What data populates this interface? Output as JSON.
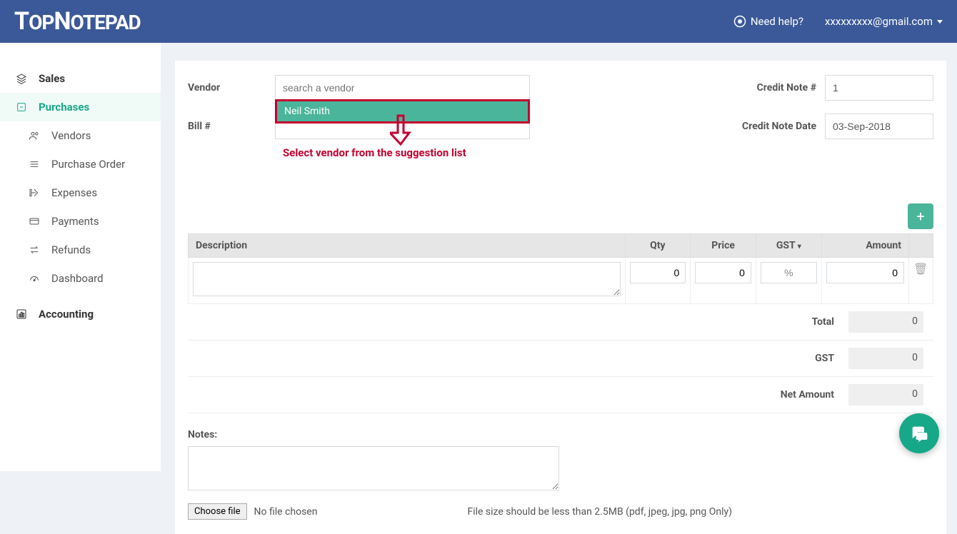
{
  "header": {
    "logo": "TOPNOTEPAD",
    "help": "Need help?",
    "user": "xxxxxxxxx@gmail.com"
  },
  "sidebar": {
    "sales": "Sales",
    "purchases": "Purchases",
    "vendors": "Vendors",
    "purchaseOrder": "Purchase Order",
    "expenses": "Expenses",
    "payments": "Payments",
    "refunds": "Refunds",
    "dashboard": "Dashboard",
    "accounting": "Accounting"
  },
  "form": {
    "vendorLabel": "Vendor",
    "vendorPlaceholder": "search a vendor",
    "vendorValue": "",
    "billLabel": "Bill #",
    "billValue": "",
    "creditNoteNumLabel": "Credit Note #",
    "creditNoteNumValue": "1",
    "creditNoteDateLabel": "Credit Note Date",
    "creditNoteDateValue": "03-Sep-2018",
    "suggestion": "Neil Smith"
  },
  "tableHeaders": {
    "description": "Description",
    "qty": "Qty",
    "price": "Price",
    "gst": "GST",
    "amount": "Amount"
  },
  "lineItem": {
    "description": "",
    "qty": "0",
    "price": "0",
    "gstPct": "%",
    "amount": "0"
  },
  "totals": {
    "totalLabel": "Total",
    "totalValue": "0",
    "gstLabel": "GST",
    "gstValue": "0",
    "netLabel": "Net Amount",
    "netValue": "0"
  },
  "notes": {
    "label": "Notes:",
    "value": ""
  },
  "file": {
    "button": "Choose file",
    "status": "No file chosen",
    "hint": "File size should be less than 2.5MB (pdf, jpeg, jpg, png Only)"
  },
  "annotation": {
    "text": "Select vendor from the suggestion list"
  },
  "addBtn": "+"
}
